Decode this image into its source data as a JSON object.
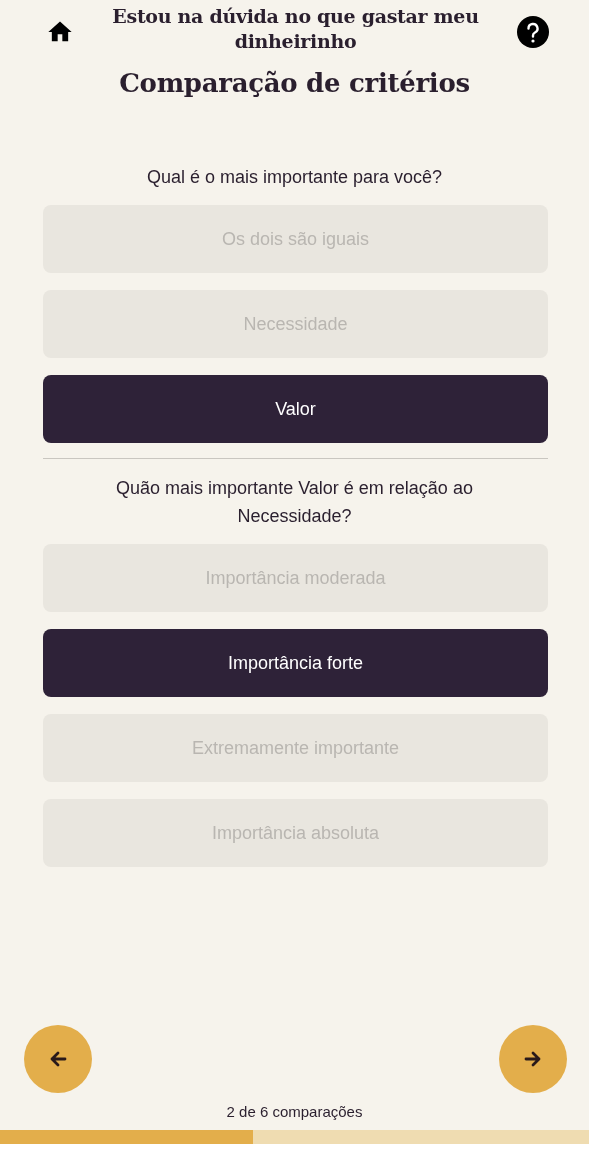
{
  "header": {
    "title": "Estou na dúvida no que gastar meu dinheirinho"
  },
  "page_title": "Comparação de critérios",
  "question": "Qual é o mais importante para você?",
  "choices": [
    {
      "label": "Os dois são iguais",
      "selected": false
    },
    {
      "label": "Necessidade",
      "selected": false
    },
    {
      "label": "Valor",
      "selected": true
    }
  ],
  "intensity_question": "Quão mais importante Valor é em relação ao Necessidade?",
  "intensities": [
    {
      "label": "Importância moderada",
      "selected": false
    },
    {
      "label": "Importância forte",
      "selected": true
    },
    {
      "label": "Extremamente importante",
      "selected": false
    },
    {
      "label": "Importância absoluta",
      "selected": false
    }
  ],
  "counter": "2 de 6 comparações",
  "progress": {
    "level": 0.43
  }
}
